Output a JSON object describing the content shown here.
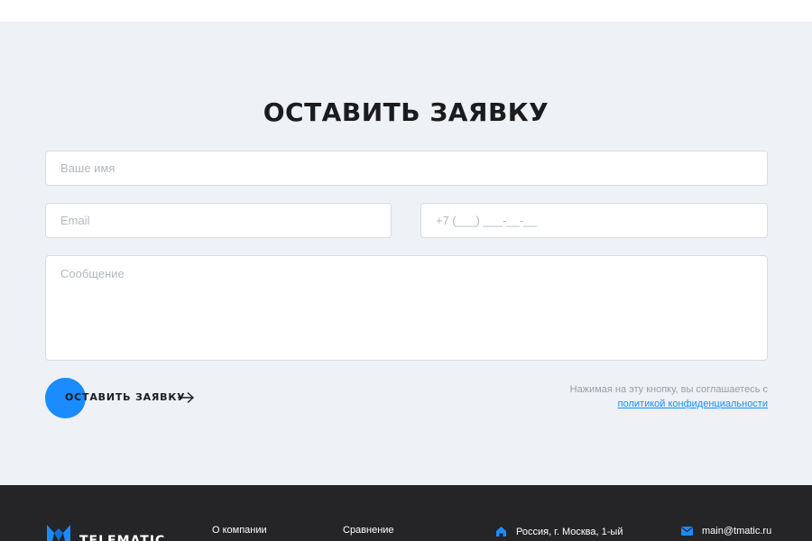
{
  "form": {
    "title": "ОСТАВИТЬ ЗАЯВКУ",
    "name_placeholder": "Ваше имя",
    "email_placeholder": "Email",
    "phone_placeholder": "+7 (___) ___-__-__",
    "message_placeholder": "Сообщение",
    "submit_label": "ОСТАВИТЬ ЗАЯВКУ",
    "consent_text": "Нажимая на эту кнопку, вы соглашаетесь с",
    "consent_link": "политикой конфиденциальности",
    "accent_color": "#1a8cff"
  },
  "footer": {
    "logo_text": "TELEMATIC",
    "links": [
      "О компании",
      "Сравнение"
    ],
    "address": "Россия, г. Москва, 1-ый",
    "email": "main@tmatic.ru",
    "background": "#252527"
  },
  "icons": {
    "submit": "arrow-right-icon",
    "address": "location-icon",
    "email": "mail-icon",
    "logo": "logo-icon"
  }
}
